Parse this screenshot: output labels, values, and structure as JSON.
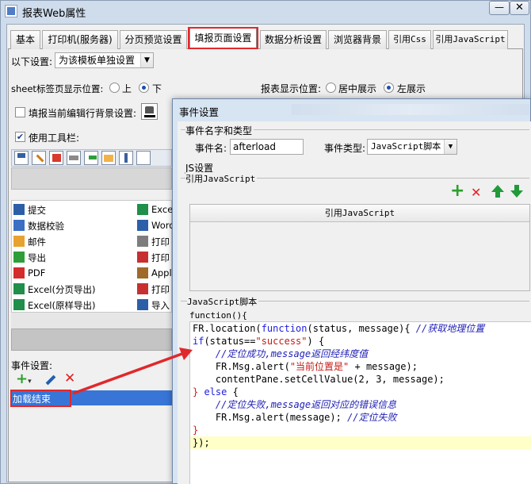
{
  "window": {
    "title": "报表Web属性",
    "min_glyph": "—",
    "close_glyph": "✕"
  },
  "tabs": [
    {
      "label": "基本"
    },
    {
      "label": "打印机(服务器)"
    },
    {
      "label": "分页预览设置"
    },
    {
      "label": "填报页面设置",
      "active": true
    },
    {
      "label": "数据分析设置"
    },
    {
      "label": "浏览器背景"
    },
    {
      "label": "引用Css"
    },
    {
      "label": "引用JavaScript"
    }
  ],
  "settings": {
    "scope_label": "以下设置:",
    "scope_value": "为该模板单独设置",
    "sheet_tab_label": "sheet标签页显示位置:",
    "sheet_tab_top": "上",
    "sheet_tab_bottom": "下",
    "sheet_tab_selected": "下",
    "report_pos_label": "报表显示位置:",
    "report_pos_center": "居中展示",
    "report_pos_left": "左展示",
    "report_pos_selected": "左展示",
    "fill_bg_label": "填报当前编辑行背景设置:",
    "use_toolbar_label": "使用工具栏:",
    "use_toolbar_checked": true
  },
  "toolbar_items": [
    {
      "icon": "submit-icon",
      "label": "提交"
    },
    {
      "icon": "validate-icon",
      "label": "数据校验"
    },
    {
      "icon": "email-icon",
      "label": "邮件"
    },
    {
      "icon": "export-icon",
      "label": "导出"
    },
    {
      "icon": "pdf-icon",
      "label": "PDF"
    },
    {
      "icon": "excel-page-icon",
      "label": "Excel(分页导出)"
    },
    {
      "icon": "excel-original-icon",
      "label": "Excel(原样导出)"
    }
  ],
  "toolbar_items_right": [
    {
      "icon": "excel-icon",
      "label": "Exce"
    },
    {
      "icon": "word-icon",
      "label": "Word"
    },
    {
      "icon": "print-icon",
      "label": "打印"
    },
    {
      "icon": "print-pdf-icon",
      "label": "打印"
    },
    {
      "icon": "applet-icon",
      "label": "Appl"
    },
    {
      "icon": "print-local-icon",
      "label": "打印"
    },
    {
      "icon": "import-icon",
      "label": "导入"
    }
  ],
  "events": {
    "label": "事件设置:",
    "item": "加载结束"
  },
  "dialog": {
    "title": "事件设置",
    "name_type_group": "事件名字和类型",
    "name_label": "事件名:",
    "name_value": "afterload",
    "type_label": "事件类型:",
    "type_value": "JavaScript脚本",
    "js_settings": "JS设置",
    "ref_js_group": "引用JavaScript",
    "ref_js_header": "引用JavaScript",
    "script_group": "JavaScript脚本",
    "func_open": "function(){"
  },
  "code_lines": [
    [
      [
        "FR.location(",
        ""
      ],
      [
        "function",
        "kw"
      ],
      [
        "(status, message){ ",
        ""
      ],
      [
        "//获取地理位置",
        "cmt"
      ]
    ],
    [
      [
        "if",
        "kw"
      ],
      [
        "(status==",
        ""
      ],
      [
        "\"success\"",
        "str"
      ],
      [
        ") {",
        ""
      ]
    ],
    [
      [
        "    ",
        ""
      ],
      [
        "//定位成功,message返回经纬度值",
        "cmt"
      ]
    ],
    [
      [
        "    FR.Msg.alert(",
        ""
      ],
      [
        "\"当前位置是\"",
        "str"
      ],
      [
        " + message);",
        ""
      ]
    ],
    [
      [
        "    contentPane.setCellValue(2, 3, message);",
        ""
      ]
    ],
    [
      [
        "}",
        "br"
      ],
      [
        " ",
        ""
      ],
      [
        "else",
        "kw"
      ],
      [
        " {",
        ""
      ]
    ],
    [
      [
        "    ",
        ""
      ],
      [
        "//定位失败,message返回对应的错误信息",
        "cmt"
      ]
    ],
    [
      [
        "    FR.Msg.alert(message); ",
        ""
      ],
      [
        "//定位失败",
        "cmt"
      ]
    ],
    [
      [
        "}",
        "br"
      ]
    ],
    [
      [
        "});",
        ""
      ]
    ]
  ],
  "colors": {
    "highlight": "#e0282c",
    "selection": "#3875d7",
    "current_line": "#ffffc8",
    "green": "#2ca02c",
    "red": "#e02020"
  }
}
